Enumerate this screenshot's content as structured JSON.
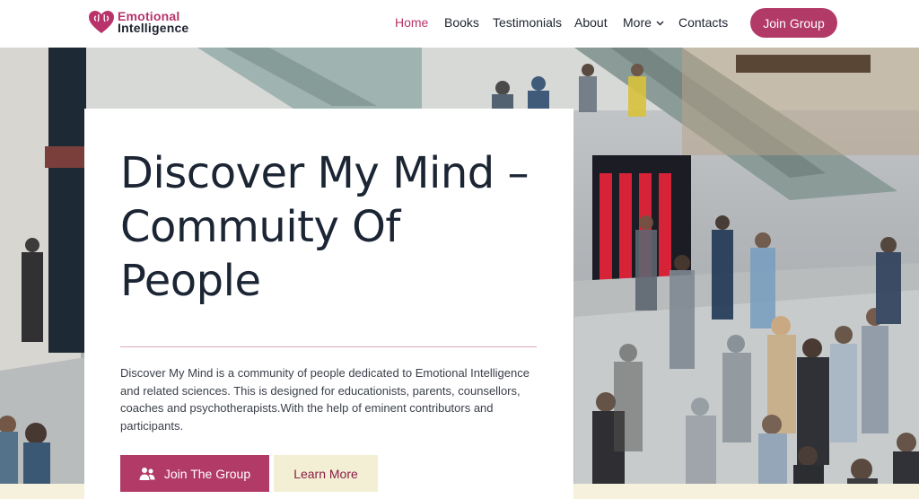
{
  "brand": {
    "line1": "Emotional",
    "line2": "Intelligence",
    "accent_color": "#b23a66"
  },
  "nav": {
    "items": [
      {
        "label": "Home",
        "active": true
      },
      {
        "label": "Books"
      },
      {
        "label": "Testimonials"
      },
      {
        "label": "About"
      },
      {
        "label": "More",
        "icon": "chevron-down-icon"
      },
      {
        "label": "Contacts"
      }
    ],
    "cta_label": "Join Group"
  },
  "hero": {
    "background": "photo of crowded station concourse with escalators",
    "title": "Discover My Mind – Commuity Of People",
    "description": "Discover My Mind is a community of people dedicated to Emotional Intelligence and related sciences. This is designed for educationists, parents, counsellors, coaches and psychotherapists.With the help of eminent contributors and participants.",
    "primary_button": {
      "label": "Join The Group",
      "icon": "users-icon"
    },
    "secondary_button": {
      "label": "Learn More"
    }
  }
}
